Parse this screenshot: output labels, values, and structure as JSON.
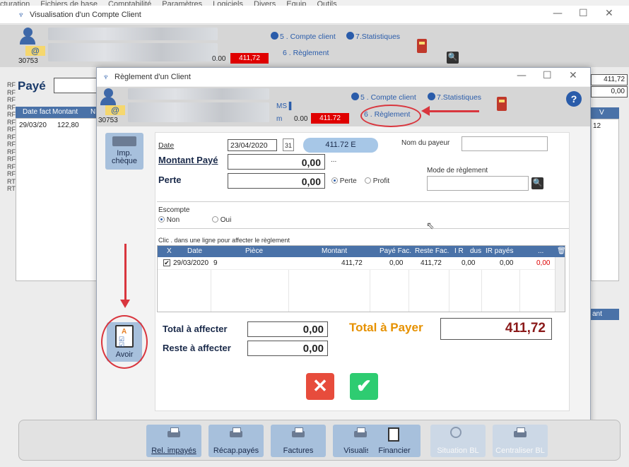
{
  "app_menu": [
    "cturation",
    "Fichiers de base",
    "Comptabilité",
    "Paramètres",
    "Logiciels",
    "Divers",
    "Equip",
    "Outils"
  ],
  "outer_window": {
    "title": "Visualisation d'un Compte Client",
    "client_code": "30753",
    "amount_zero": "0.00",
    "amount_red": "411,72",
    "link_compte": "5 . Compte client",
    "link_stats": "7.Statistiques",
    "link_reglement": "6 . Règlement",
    "paye_label": "Payé",
    "right_values": [
      "411,72",
      "0,00"
    ],
    "grid_headers": [
      "Date fact",
      "Montant",
      "N"
    ],
    "grid_row": [
      "29/03/20",
      "122,80"
    ],
    "right_col_header": "V",
    "right_col_value": "12",
    "right_col2_header": "ant",
    "left_codes": [
      "RF",
      "RF",
      "RF",
      "RF",
      "RF",
      "RF",
      "RF",
      "RF",
      "RF",
      "RF",
      "RF",
      "RF",
      "RF",
      "RT",
      "RT"
    ]
  },
  "dialog": {
    "title": "Règlement d'un Client",
    "client_code": "30753",
    "ms_label": "MS",
    "m_label": "m",
    "amount_zero": "0.00",
    "amount_red": "411.72",
    "link_compte": "5 . Compte client",
    "link_stats": "7.Statistiques",
    "link_reglement": "6 . Règlement",
    "help": "?",
    "imp_cheque_label": "Imp. chèque",
    "avoir_label": "Avoir",
    "date_label": "Date",
    "date_value": "23/04/2020",
    "calendar_day": "31",
    "amount_pill": "411.72 E",
    "nom_payeur_label": "Nom du payeur",
    "montant_paye_label": "Montant Payé",
    "montant_paye_value": "0,00",
    "ellipsis": "...",
    "perte_label": "Perte",
    "perte_value": "0,00",
    "radio_perte": "Perte",
    "radio_profit": "Profit",
    "mode_reglement_label": "Mode de règlement",
    "escompte_label": "Escompte",
    "radio_non": "Non",
    "radio_oui": "Oui",
    "table_hint": "Clic . dans une ligne pour affecter le règlement",
    "table_headers": [
      "X",
      "Date",
      "Pièce",
      "Montant",
      "Payé Fac.",
      "Reste Fac.",
      "I R",
      "dus",
      "IR payés",
      "..."
    ],
    "table_row": {
      "checked": "✔",
      "date": "29/03/2020",
      "piece": "9",
      "montant": "411,72",
      "paye": "0,00",
      "reste": "411,72",
      "ir_dus": "0,00",
      "ir_payes": "0,00",
      "last": "0,00"
    },
    "total_affecter_label": "Total à affecter",
    "total_affecter_value": "0,00",
    "reste_affecter_label": "Reste à affecter",
    "reste_affecter_value": "0,00",
    "total_payer_label": "Total à Payer",
    "total_payer_value": "411,72"
  },
  "toolbar": {
    "buttons": [
      {
        "label": "Rel. impayés",
        "enabled": true
      },
      {
        "label": "Récap.payés",
        "enabled": true
      },
      {
        "label": "Factures",
        "enabled": true
      },
      {
        "label": "Visualiser",
        "enabled": true
      },
      {
        "label": "Financier",
        "enabled": true
      },
      {
        "label": "Situation BL",
        "enabled": false
      },
      {
        "label": "Centraliser BL",
        "enabled": false
      }
    ]
  },
  "colors": {
    "accent_blue": "#2a5caa",
    "header_blue": "#4a72a8",
    "red_amount": "#e00000",
    "orange_total": "#e69100",
    "annotation_red": "#d9363e"
  }
}
